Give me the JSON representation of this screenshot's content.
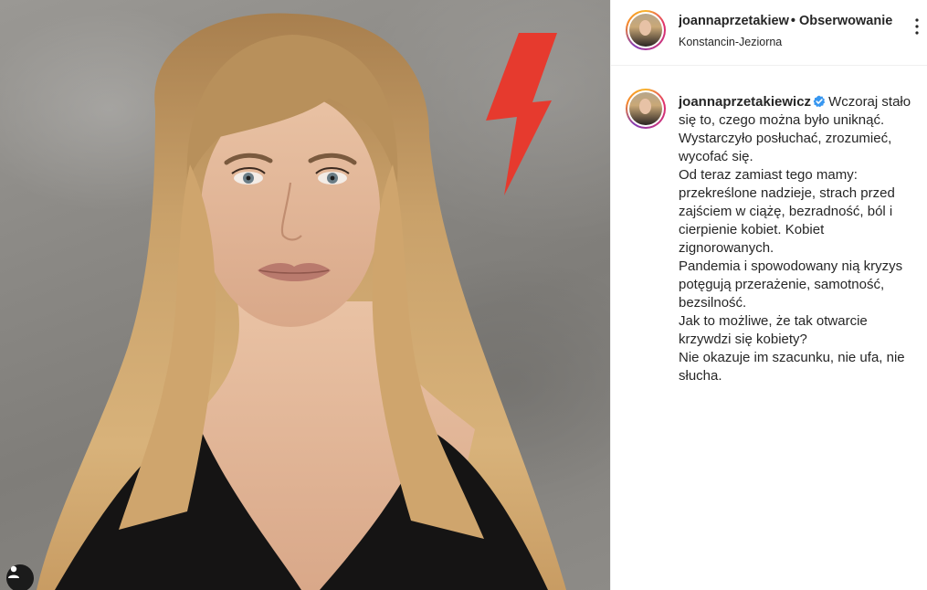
{
  "post": {
    "author": "joannaprzetakiewicz",
    "author_truncated": "joannaprzetakiew",
    "separator": "•",
    "follow_label": "Obserwowanie",
    "location": "Konstancin-Jeziorna",
    "more_icon": "more-vertical-icon",
    "verified_color": "#3897f0"
  },
  "caption": {
    "username": "joannaprzetakiewicz",
    "first_line": "Wczoraj stało się to, czego można było uniknąć. Wystarczyło posłuchać, zrozumieć, wycofać się.",
    "lines": [
      "Od teraz zamiast tego mamy: przekreślone nadzieje, strach przed zajściem w ciążę, bezradność, ból i cierpienie kobiet. Kobiet zignorowanych.",
      "Pandemia i spowodowany nią kryzys potęgują przerażenie, samotność, bezsilność.",
      "Jak to możliwe, że tak otwarcie krzywdzi się kobiety?",
      "Nie okazuje im szacunku, nie ufa, nie słucha."
    ]
  },
  "photo": {
    "bolt_color": "#e63a2e",
    "user_tag_icon": "person-icon"
  }
}
